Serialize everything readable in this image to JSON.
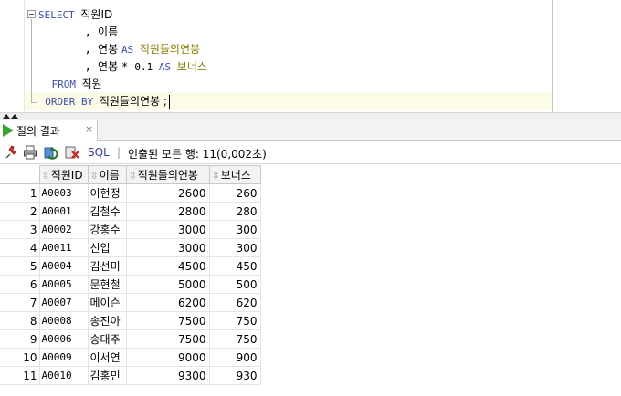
{
  "editor": {
    "lines": [
      {
        "indent": "",
        "parts": [
          {
            "t": "kw",
            "v": "SELECT "
          },
          {
            "t": "id",
            "v": "직원ID"
          }
        ]
      },
      {
        "indent": "       ",
        "parts": [
          {
            "t": "op",
            "v": ", "
          },
          {
            "t": "id",
            "v": "이름"
          }
        ]
      },
      {
        "indent": "       ",
        "parts": [
          {
            "t": "op",
            "v": ", "
          },
          {
            "t": "id",
            "v": "연봉 "
          },
          {
            "t": "kw",
            "v": "AS "
          },
          {
            "t": "alias",
            "v": "직원들의연봉"
          }
        ]
      },
      {
        "indent": "       ",
        "parts": [
          {
            "t": "op",
            "v": ", "
          },
          {
            "t": "id",
            "v": "연봉 "
          },
          {
            "t": "op",
            "v": "* "
          },
          {
            "t": "num",
            "v": "0.1 "
          },
          {
            "t": "kw",
            "v": "AS "
          },
          {
            "t": "alias",
            "v": "보너스"
          }
        ]
      },
      {
        "indent": "  ",
        "parts": [
          {
            "t": "kw",
            "v": "FROM "
          },
          {
            "t": "id",
            "v": "직원"
          }
        ]
      },
      {
        "indent": " ",
        "parts": [
          {
            "t": "kw",
            "v": "ORDER BY "
          },
          {
            "t": "id",
            "v": "직원들의연봉 ;"
          }
        ]
      }
    ]
  },
  "results_tab": {
    "label": "질의 결과",
    "close": "×"
  },
  "toolbar": {
    "icons": [
      "pin-icon",
      "print-icon",
      "refresh-icon",
      "clear-icon"
    ],
    "sql_label": "SQL",
    "separator": "|",
    "status": "인출된 모든 행: 11(0,002초)"
  },
  "grid": {
    "columns": [
      "직원ID",
      "이름",
      "직원들의연봉",
      "보너스"
    ],
    "rows": [
      [
        "1",
        "A0003",
        "이현정",
        "2600",
        "260"
      ],
      [
        "2",
        "A0001",
        "김철수",
        "2800",
        "280"
      ],
      [
        "3",
        "A0002",
        "강홍수",
        "3000",
        "300"
      ],
      [
        "4",
        "A0011",
        "신입",
        "3000",
        "300"
      ],
      [
        "5",
        "A0004",
        "김선미",
        "4500",
        "450"
      ],
      [
        "6",
        "A0005",
        "문현철",
        "5000",
        "500"
      ],
      [
        "7",
        "A0007",
        "메이슨",
        "6200",
        "620"
      ],
      [
        "8",
        "A0008",
        "송진아",
        "7500",
        "750"
      ],
      [
        "9",
        "A0006",
        "송대주",
        "7500",
        "750"
      ],
      [
        "10",
        "A0009",
        "이서연",
        "9000",
        "900"
      ],
      [
        "11",
        "A0010",
        "김홍민",
        "9300",
        "930"
      ]
    ]
  },
  "colors": {
    "keyword": "#3a4fb8",
    "alias": "#8a7c00",
    "run": "#35a82b",
    "sql_link": "#2f3e9e"
  }
}
